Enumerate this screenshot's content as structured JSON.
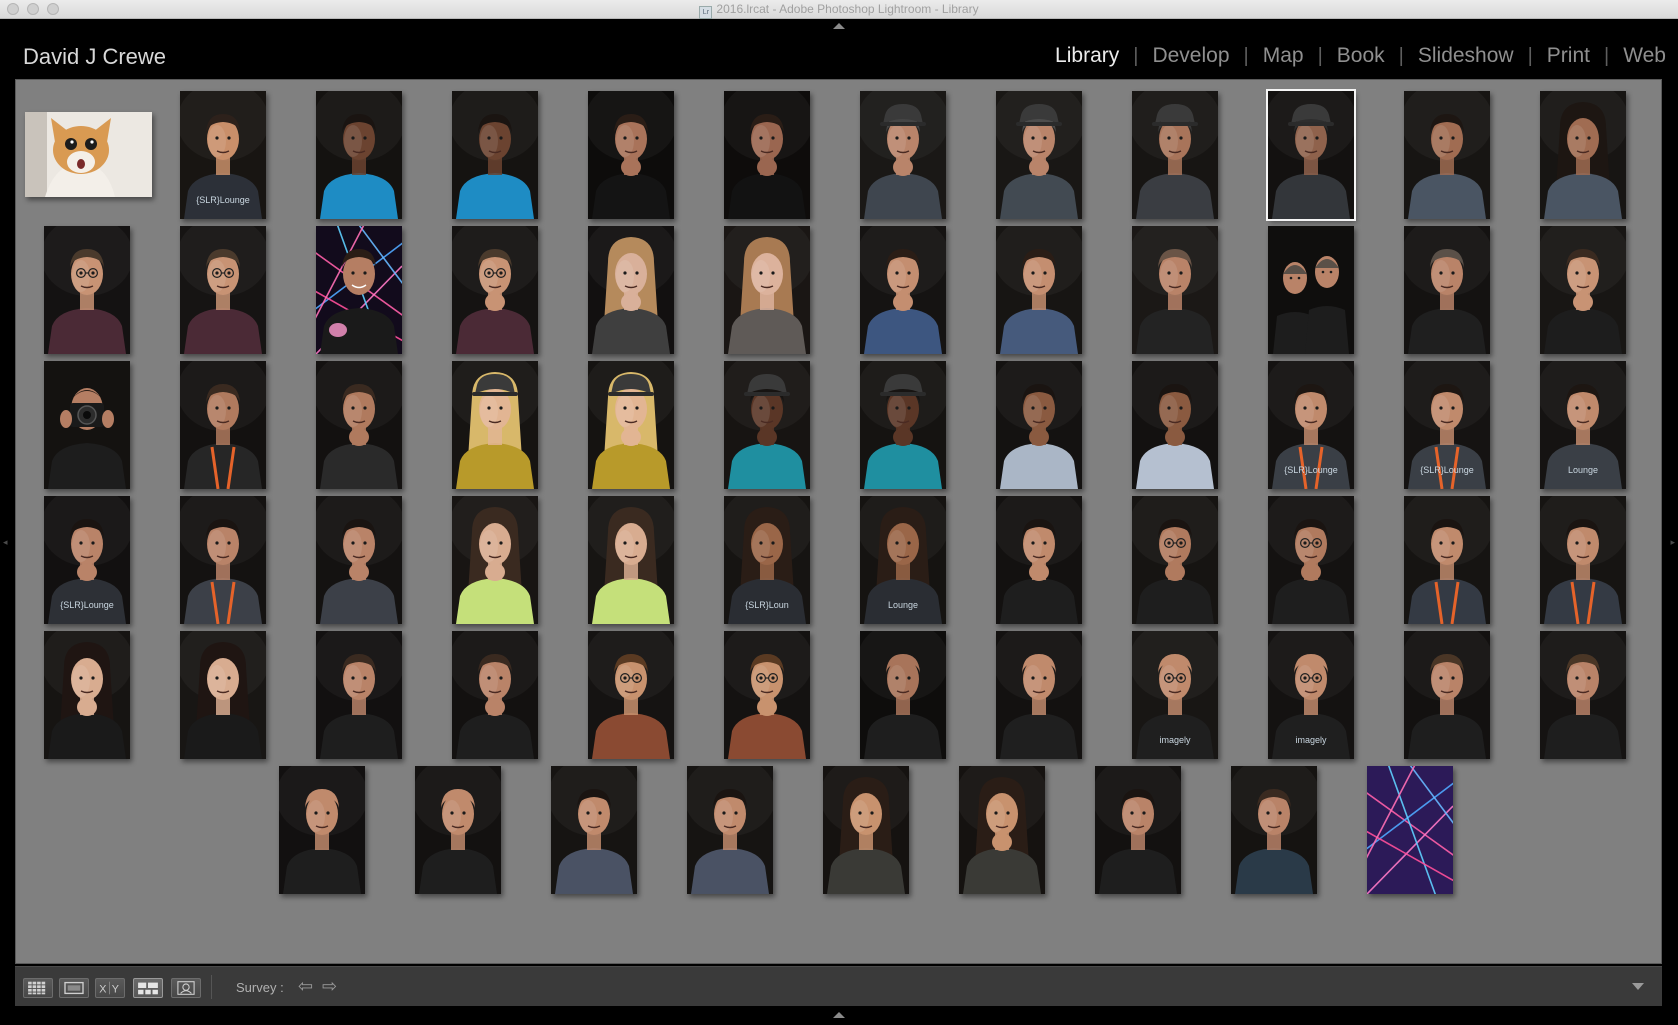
{
  "window": {
    "title": "2016.lrcat - Adobe Photoshop Lightroom - Library",
    "app_badge": "Lr"
  },
  "identity_plate": "David J Crewe",
  "modules": [
    {
      "label": "Library",
      "active": true
    },
    {
      "label": "Develop",
      "active": false
    },
    {
      "label": "Map",
      "active": false
    },
    {
      "label": "Book",
      "active": false
    },
    {
      "label": "Slideshow",
      "active": false
    },
    {
      "label": "Print",
      "active": false
    },
    {
      "label": "Web",
      "active": false
    }
  ],
  "survey": {
    "rows": [
      [
        {
          "kind": "cat",
          "orientation": "landscape",
          "bg": "#ece8e2",
          "skin": "#d99a52",
          "shirt": "#f3efe9"
        },
        {
          "kind": "portrait",
          "bg": "#181512",
          "skin": "#c98f6a",
          "shirt": "#2c3038",
          "hair": "#2d211b",
          "logo": "{SLR}Lounge"
        },
        {
          "kind": "portrait",
          "bg": "#141210",
          "skin": "#6b4330",
          "shirt": "#1e8cc4",
          "hair": "#1a1411"
        },
        {
          "kind": "portrait",
          "bg": "#151311",
          "skin": "#6b4330",
          "shirt": "#1e8cc4",
          "hair": "#1a1411"
        },
        {
          "kind": "portrait",
          "bg": "#0d0c0b",
          "skin": "#a9735a",
          "shirt": "#141414",
          "hair": "#2a1d16",
          "hands": true
        },
        {
          "kind": "portrait",
          "bg": "#0e0c0b",
          "skin": "#9a6650",
          "shirt": "#121212",
          "hair": "#2a1d16",
          "hands": true
        },
        {
          "kind": "portrait",
          "bg": "#1a1816",
          "skin": "#b9846a",
          "shirt": "#3f464f",
          "hair": "#454545",
          "hat": true,
          "hands": true
        },
        {
          "kind": "portrait",
          "bg": "#191715",
          "skin": "#b9846a",
          "shirt": "#424a52",
          "hair": "#4d4d4d",
          "hat": true,
          "hands": true
        },
        {
          "kind": "portrait",
          "bg": "#171513",
          "skin": "#a8745a",
          "shirt": "#3a3d42",
          "hair": "#3a3a3a",
          "hat": true
        },
        {
          "kind": "portrait",
          "bg": "#131110",
          "skin": "#8f624c",
          "shirt": "#33363a",
          "hair": "#2e2e2e",
          "hat": true,
          "selected": true
        },
        {
          "kind": "portrait",
          "bg": "#171513",
          "skin": "#a06c52",
          "shirt": "#4a5563",
          "hair": "#1d1612"
        },
        {
          "kind": "portrait",
          "bg": "#171513",
          "skin": "#a06c52",
          "shirt": "#4a5563",
          "hair": "#1d1612",
          "long_hair": true
        }
      ],
      [
        {
          "kind": "portrait",
          "bg": "#141212",
          "skin": "#c89374",
          "shirt": "#4b2a36",
          "hair": "#4a3a2c",
          "glasses": true
        },
        {
          "kind": "portrait",
          "bg": "#161413",
          "skin": "#c89374",
          "shirt": "#4b2a36",
          "hair": "#4a3a2c",
          "glasses": true
        },
        {
          "kind": "laser_portrait",
          "bg": "#120b1c",
          "skin": "#b57e63",
          "shirt": "#1a1a1a",
          "hair": "#2a1d16"
        },
        {
          "kind": "portrait",
          "bg": "#151312",
          "skin": "#c89374",
          "shirt": "#4b2a36",
          "hair": "#4a3a2c",
          "glasses": true,
          "hands": true
        },
        {
          "kind": "portrait",
          "bg": "#121010",
          "skin": "#d9b09a",
          "shirt": "#3f3f3f",
          "hair": "#b58a5c",
          "long_hair": true,
          "hands": true
        },
        {
          "kind": "portrait",
          "bg": "#1a1614",
          "skin": "#dcb29c",
          "shirt": "#5f5a57",
          "hair": "#a87a52",
          "long_hair": true
        },
        {
          "kind": "portrait",
          "bg": "#151312",
          "skin": "#c48e70",
          "shirt": "#3d5680",
          "hair": "#2a1d16",
          "hands": true
        },
        {
          "kind": "portrait",
          "bg": "#171513",
          "skin": "#c48e70",
          "shirt": "#465a7c",
          "hair": "#2a1d16"
        },
        {
          "kind": "portrait",
          "bg": "#1b1816",
          "skin": "#b98368",
          "shirt": "#232323",
          "hair": "#6a5446"
        },
        {
          "kind": "pair",
          "bg": "#0f0e0d",
          "skin": "#b98368",
          "shirt": "#1d1d1d",
          "hair": "#5a5048"
        },
        {
          "kind": "portrait",
          "bg": "#141211",
          "skin": "#b98368",
          "shirt": "#1f1f1f",
          "hair": "#5a5048"
        },
        {
          "kind": "portrait",
          "bg": "#181614",
          "skin": "#c89374",
          "shirt": "#1d1d1d",
          "hair": "#3a2a20",
          "hands": true
        }
      ],
      [
        {
          "kind": "camera",
          "bg": "#141210",
          "skin": "#b57e63",
          "shirt": "#1d1d1d",
          "hair": "#2a1d16"
        },
        {
          "kind": "portrait",
          "bg": "#131110",
          "skin": "#b07a5e",
          "shirt": "#262626",
          "hair": "#3a2a20",
          "lanyard": true
        },
        {
          "kind": "portrait",
          "bg": "#131110",
          "skin": "#b07a5e",
          "shirt": "#2a2a2a",
          "hair": "#3a2a20",
          "hands": true
        },
        {
          "kind": "portrait",
          "bg": "#161412",
          "skin": "#e2b593",
          "shirt": "#b89a2a",
          "hair": "#d8b86a",
          "hat": true,
          "long_hair": true
        },
        {
          "kind": "portrait",
          "bg": "#151311",
          "skin": "#e2b593",
          "shirt": "#b89a2a",
          "hair": "#d8b86a",
          "hat": true,
          "long_hair": true,
          "hands": true
        },
        {
          "kind": "portrait",
          "bg": "#171412",
          "skin": "#5a3626",
          "shirt": "#1f8fa0",
          "hair": "#171412",
          "hat": true,
          "hands": true
        },
        {
          "kind": "portrait",
          "bg": "#151311",
          "skin": "#5a3626",
          "shirt": "#1f8fa0",
          "hair": "#171412",
          "hat": true,
          "hands": true
        },
        {
          "kind": "portrait",
          "bg": "#141211",
          "skin": "#8a5a40",
          "shirt": "#aab6c6",
          "hair": "#1a1411",
          "hands": true
        },
        {
          "kind": "portrait",
          "bg": "#131110",
          "skin": "#8a5a40",
          "shirt": "#b5c0d0",
          "hair": "#1a1411",
          "hands": true
        },
        {
          "kind": "portrait",
          "bg": "#141211",
          "skin": "#c08a6c",
          "shirt": "#3a3f46",
          "hair": "#1d1612",
          "lanyard": true,
          "logo": "{SLR}Lounge"
        },
        {
          "kind": "portrait",
          "bg": "#151312",
          "skin": "#c08a6c",
          "shirt": "#3a3f46",
          "hair": "#1d1612",
          "lanyard": true,
          "logo": "{SLR}Lounge"
        },
        {
          "kind": "portrait",
          "bg": "#151312",
          "skin": "#c08a6c",
          "shirt": "#3a3f46",
          "hair": "#1d1612",
          "logo": "Lounge"
        }
      ],
      [
        {
          "kind": "portrait",
          "bg": "#121010",
          "skin": "#b98368",
          "shirt": "#2d3036",
          "hair": "#1a1411",
          "hands": true,
          "logo": "{SLR}Lounge"
        },
        {
          "kind": "portrait",
          "bg": "#141211",
          "skin": "#b98368",
          "shirt": "#3c4048",
          "hair": "#1a1411",
          "lanyard": true
        },
        {
          "kind": "portrait",
          "bg": "#141211",
          "skin": "#b98368",
          "shirt": "#3c4048",
          "hair": "#1a1411",
          "hands": true
        },
        {
          "kind": "portrait",
          "bg": "#181513",
          "skin": "#d8ac90",
          "shirt": "#c5e07a",
          "hair": "#3a2a20",
          "long_hair": true,
          "hands": true
        },
        {
          "kind": "portrait",
          "bg": "#171513",
          "skin": "#d8ac90",
          "shirt": "#c5e07a",
          "hair": "#3a2a20",
          "long_hair": true
        },
        {
          "kind": "portrait",
          "bg": "#161412",
          "skin": "#9a6648",
          "shirt": "#2a2d33",
          "hair": "#2a1d16",
          "long_hair": true,
          "logo": "{SLR}Loun"
        },
        {
          "kind": "portrait",
          "bg": "#151311",
          "skin": "#9a6648",
          "shirt": "#2a2d33",
          "hair": "#2a1d16",
          "long_hair": true,
          "logo": "Lounge"
        },
        {
          "kind": "portrait",
          "bg": "#131110",
          "skin": "#c08a6c",
          "shirt": "#1e1e1e",
          "hair": "#1a1411",
          "hands": true
        },
        {
          "kind": "portrait",
          "bg": "#161412",
          "skin": "#b07a5e",
          "shirt": "#1e1e1e",
          "hair": "#1a1411",
          "glasses": true,
          "hands": true
        },
        {
          "kind": "portrait",
          "bg": "#141211",
          "skin": "#b07a5e",
          "shirt": "#1e1e1e",
          "hair": "#1a1411",
          "glasses": true,
          "hands": true
        },
        {
          "kind": "portrait",
          "bg": "#161412",
          "skin": "#c08a6c",
          "shirt": "#343a44",
          "hair": "#1a1411",
          "lanyard": true
        },
        {
          "kind": "portrait",
          "bg": "#161412",
          "skin": "#c08a6c",
          "shirt": "#343a44",
          "hair": "#1a1411",
          "lanyard": true
        }
      ],
      [
        {
          "kind": "portrait",
          "bg": "#161412",
          "skin": "#d8ac90",
          "shirt": "#1a1a1a",
          "hair": "#1f1512",
          "long_hair": true,
          "hands": true
        },
        {
          "kind": "portrait",
          "bg": "#181614",
          "skin": "#d8ac90",
          "shirt": "#1a1a1a",
          "hair": "#1f1512",
          "long_hair": true
        },
        {
          "kind": "portrait",
          "bg": "#121010",
          "skin": "#b98368",
          "shirt": "#1e1e1e",
          "hair": "#3a2a20"
        },
        {
          "kind": "portrait",
          "bg": "#131110",
          "skin": "#b98368",
          "shirt": "#1e1e1e",
          "hair": "#3a2a20",
          "hands": true
        },
        {
          "kind": "portrait",
          "bg": "#151312",
          "skin": "#c8926e",
          "shirt": "#8a4a32",
          "hair": "#5a3a22",
          "glasses": true
        },
        {
          "kind": "portrait",
          "bg": "#141211",
          "skin": "#c8926e",
          "shirt": "#8a4a32",
          "hair": "#5a3a22",
          "glasses": true,
          "hands": true
        },
        {
          "kind": "portrait",
          "bg": "#0e0d0c",
          "skin": "#a8745a",
          "shirt": "#1e1e1e",
          "hair": "#a8745a"
        },
        {
          "kind": "portrait",
          "bg": "#131110",
          "skin": "#c08a6c",
          "shirt": "#1f1f1f",
          "hair": "#c08a6c"
        },
        {
          "kind": "portrait",
          "bg": "#181614",
          "skin": "#c08a6c",
          "shirt": "#1f1f1f",
          "hair": "#c08a6c",
          "glasses": true,
          "logo": "imagely"
        },
        {
          "kind": "portrait",
          "bg": "#141211",
          "skin": "#c08a6c",
          "shirt": "#1f1f1f",
          "hair": "#c08a6c",
          "glasses": true,
          "logo": "imagely"
        },
        {
          "kind": "portrait",
          "bg": "#131110",
          "skin": "#b98368",
          "shirt": "#1e1e1e",
          "hair": "#4a3626"
        },
        {
          "kind": "portrait",
          "bg": "#151312",
          "skin": "#b98368",
          "shirt": "#1e1e1e",
          "hair": "#4a3626"
        }
      ],
      [
        {
          "kind": "portrait",
          "bg": "#121010",
          "skin": "#c08a6c",
          "shirt": "#1e1e1e",
          "hair": "#c08a6c"
        },
        {
          "kind": "portrait",
          "bg": "#131110",
          "skin": "#c08a6c",
          "shirt": "#1e1e1e",
          "hair": "#c08a6c"
        },
        {
          "kind": "portrait",
          "bg": "#161412",
          "skin": "#c08a6c",
          "shirt": "#4a5264",
          "hair": "#1a1411"
        },
        {
          "kind": "portrait",
          "bg": "#161412",
          "skin": "#c08a6c",
          "shirt": "#4a5264",
          "hair": "#1a1411"
        },
        {
          "kind": "portrait",
          "bg": "#151210",
          "skin": "#c8926e",
          "shirt": "#3a3a36",
          "hair": "#2a1d16",
          "long_hair": true
        },
        {
          "kind": "portrait",
          "bg": "#151210",
          "skin": "#c8926e",
          "shirt": "#3a3a36",
          "hair": "#2a1d16",
          "long_hair": true,
          "hands": true
        },
        {
          "kind": "portrait",
          "bg": "#131110",
          "skin": "#b98368",
          "shirt": "#1e1e1e",
          "hair": "#1a1411"
        },
        {
          "kind": "portrait",
          "bg": "#151311",
          "skin": "#b98368",
          "shirt": "#2a3a48",
          "hair": "#3a2a20"
        },
        {
          "kind": "lasers",
          "bg": "#2c1a58"
        }
      ]
    ]
  },
  "toolbar": {
    "view_buttons": [
      {
        "name": "grid-view-icon"
      },
      {
        "name": "loupe-view-icon"
      },
      {
        "name": "compare-view-icon"
      },
      {
        "name": "survey-view-icon"
      },
      {
        "name": "people-view-icon"
      }
    ],
    "mode_label": "Survey :",
    "prev_arrow": "⇦",
    "next_arrow": "⇨"
  }
}
